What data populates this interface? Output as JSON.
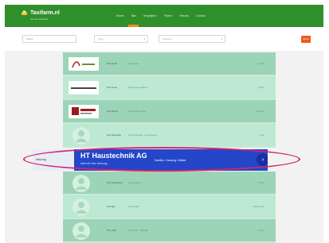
{
  "header": {
    "logo_text": "Taxifarm.nl",
    "logo_tagline": "uw taxi specialist",
    "nav": [
      {
        "label": "Home",
        "active": false
      },
      {
        "label": "Taxi",
        "active": true
      },
      {
        "label": "Vergelijken",
        "active": false
      },
      {
        "label": "Prijzen",
        "active": false
      },
      {
        "label": "Nieuws",
        "active": false
      },
      {
        "label": "Contact",
        "active": false
      }
    ]
  },
  "filters": {
    "location_placeholder": "Plaats",
    "type_placeholder": "Type",
    "sort_placeholder": "Sorteren",
    "search_label": "Zoek"
  },
  "rows": [
    {
      "logo": "logo",
      "name": "Taxi Rotte",
      "desc": "Rotterdam",
      "meta": "5 taxis"
    },
    {
      "logo": "logo",
      "name": "Taxi Hoek",
      "desc": "Hoek van Holland",
      "meta": "3 taxis"
    },
    {
      "logo": "logo",
      "name": "Taxi Rozet",
      "desc": "Amsterdam Zuid",
      "meta": "12 taxis"
    },
    {
      "logo": "",
      "name": "Taxi Westwijk",
      "desc": "Taxi Westwijk - Amstelveen",
      "meta": "1 taxi"
    },
    {
      "logo": "",
      "name": "Taxi de Baarde",
      "desc": "Leeuwarden",
      "meta": "2 taxis"
    },
    {
      "logo": "",
      "name": "Taxi Bijl",
      "desc": "Groningen",
      "meta": "Geen taxis"
    },
    {
      "logo": "",
      "name": "Taxi Jelle",
      "desc": "Taxi Jelle - Rijswijk",
      "meta": "4 taxis"
    }
  ],
  "ad": {
    "left_label": "Heizung",
    "title": "HT Haustechnik AG",
    "subtitle": "Alles für Ihre Heizung",
    "text": "Sanitär • Heizung • Bäder",
    "arrow": "›"
  }
}
